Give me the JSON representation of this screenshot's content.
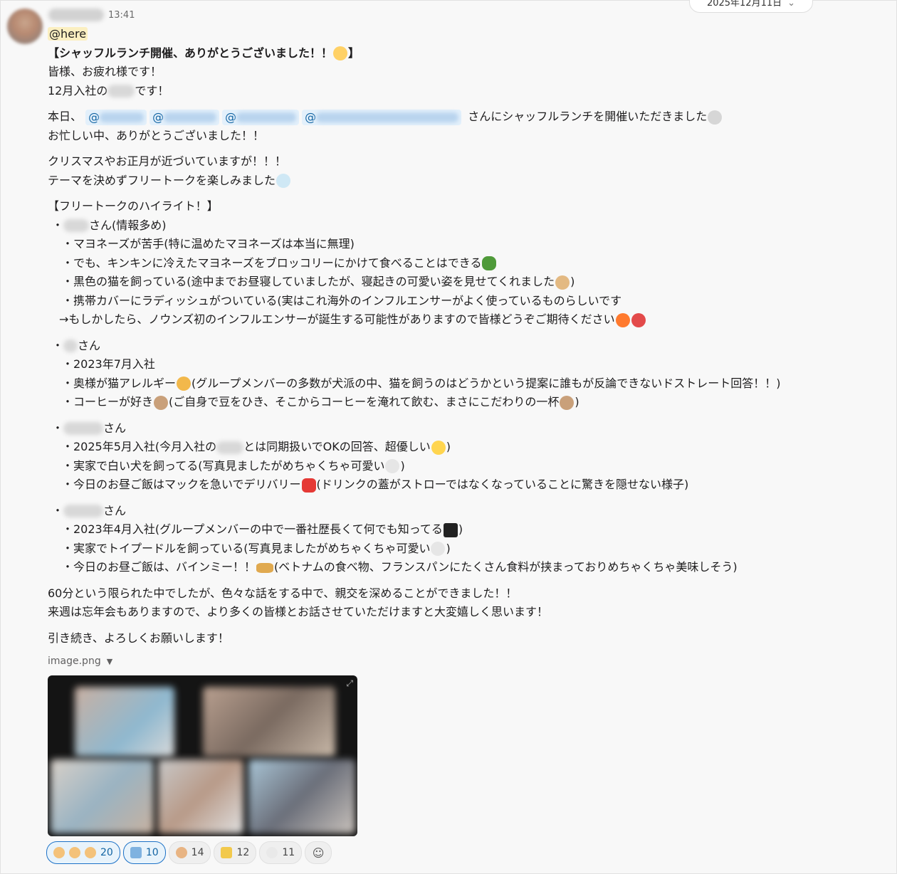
{
  "header": {
    "time": "13:41",
    "date_pill": "2025年12月11日"
  },
  "message": {
    "here": "@here",
    "title": "【シャッフルランチ開催、ありがとうございました！！",
    "title_close": "】",
    "greeting": "皆様、お疲れ様です！",
    "intro_pre": "12月入社の",
    "intro_post": "です！",
    "today_pre": "本日、",
    "today_post": "さんにシャッフルランチを開催いただきました",
    "thanks": "お忙しい中、ありがとうございました！！",
    "xmas1": "クリスマスやお正月が近づいていますが！！！",
    "xmas2": "テーマを決めずフリートークを楽しみました",
    "highlight_title": "【フリートークのハイライト！】",
    "p1_name_suffix": "さん(情報多め)",
    "p1_items": [
      "・マヨネーズが苦手(特に温めたマヨネーズは本当に無理)",
      "・でも、キンキンに冷えたマヨネーズをブロッコリーにかけて食べることはできる",
      "・黒色の猫を飼っている(途中までお昼寝していましたが、寝起きの可愛い姿を見せてくれました",
      "・携帯カバーにラディッシュがついている(実はこれ海外のインフルエンサーがよく使っているものらしいです",
      "→もしかしたら、ノウンズ初のインフルエンサーが誕生する可能性がありますので皆様どうぞご期待ください"
    ],
    "p2_name_suffix": "さん",
    "p2_items": [
      "・2023年7月入社",
      "・奥様が猫アレルギー",
      "(グループメンバーの多数が犬派の中、猫を飼うのはどうかという提案に誰もが反論できないドストレート回答！！)",
      "・コーヒーが好き",
      "(ご自身で豆をひき、そこからコーヒーを淹れて飲む、まさにこだわりの一杯"
    ],
    "p3_name_suffix": "さん",
    "p3_items": [
      "・2025年5月入社(今月入社の",
      "とは同期扱いでOKの回答、超優しい",
      "・実家で白い犬を飼ってる(写真見ましたがめちゃくちゃ可愛い",
      "・今日のお昼ご飯はマックを急いでデリバリー",
      "(ドリンクの蓋がストローではなくなっていることに驚きを隠せない様子)"
    ],
    "p4_name_suffix": "さん",
    "p4_items": [
      "・2023年4月入社(グループメンバーの中で一番社歴長くて何でも知ってる",
      "・実家でトイプードルを飼っている(写真見ましたがめちゃくちゃ可愛い",
      "・今日のお昼ご飯は、バインミー！！",
      "(ベトナムの食べ物、フランスパンにたくさん食料が挟まっておりめちゃくちゃ美味しそう)"
    ],
    "close1": "60分という限られた中でしたが、色々な話をする中で、親交を深めることができました！！",
    "close2": "来週は忘年会もありますので、より多くの皆様とお話させていただけますと大変嬉しく思います！",
    "close3": "引き続き、よろしくお願いします！",
    "paren_close": ")",
    "at": "@"
  },
  "attachment": {
    "file_name": "image.png"
  },
  "reactions": [
    {
      "count": "20",
      "selected": true,
      "color": "#f4c27a"
    },
    {
      "count": "10",
      "selected": true,
      "color": "#7fb2e0"
    },
    {
      "count": "14",
      "selected": false,
      "color": "#e8b483"
    },
    {
      "count": "12",
      "selected": false,
      "color": "#f2c94c"
    },
    {
      "count": "11",
      "selected": false,
      "color": "#e9e9e9"
    }
  ],
  "colors": {
    "mention_bg": "#e3f0fb",
    "mention_text": "#1264a3",
    "here_bg": "#fbefc1",
    "accent": "#1d72c7"
  }
}
